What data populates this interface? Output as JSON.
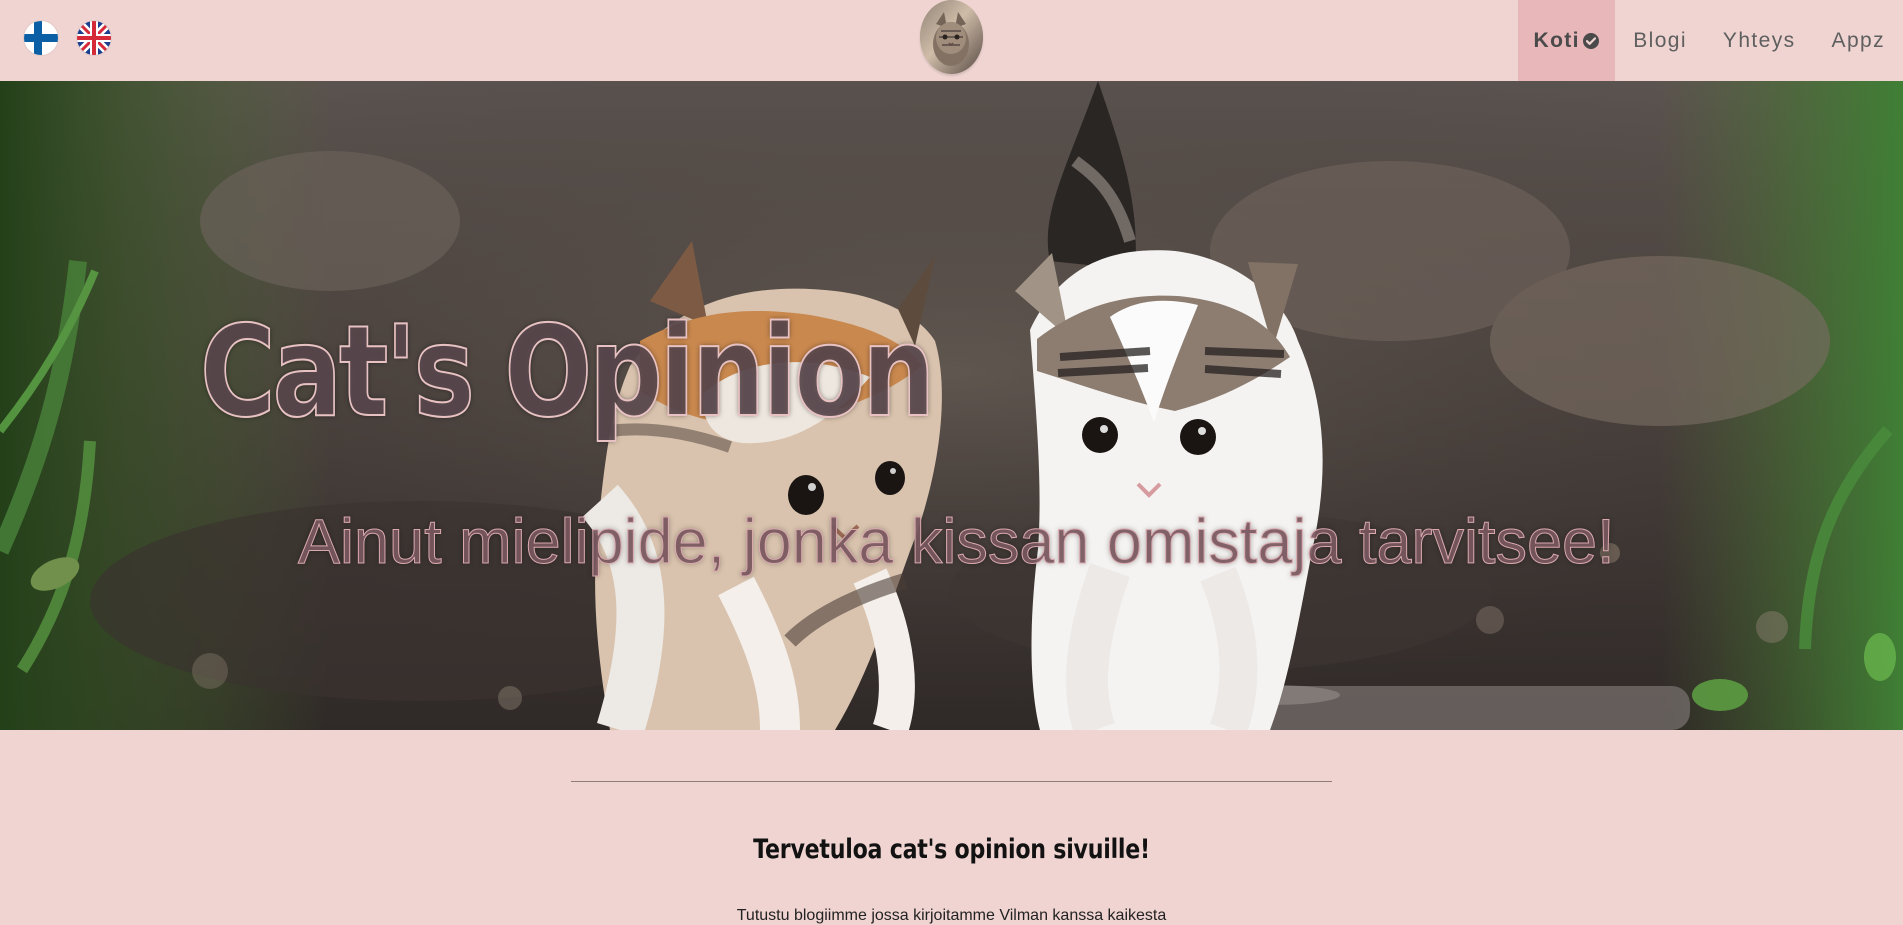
{
  "header": {
    "languages": [
      {
        "name": "fi-flag-icon"
      },
      {
        "name": "gb-flag-icon"
      }
    ],
    "logo": {
      "name": "logo-avatar-icon"
    },
    "nav": {
      "items": [
        {
          "label": "Koti",
          "active": true
        },
        {
          "label": "Blogi",
          "active": false
        },
        {
          "label": "Yhteys",
          "active": false
        },
        {
          "label": "Appz",
          "active": false
        }
      ],
      "active_icon": "check-circle-icon"
    }
  },
  "hero": {
    "title": "Cat's Opinion",
    "subtitle": "Ainut mielipide, jonka kissan omistaja tarvitsee!"
  },
  "intro": {
    "heading": "Tervetuloa cat's opinion sivuille!",
    "text": "Tutustu blogiimme jossa kirjoitamme Vilman kanssa kaikesta"
  },
  "colors": {
    "page_background": "#f0d4d2",
    "active_nav_background": "#e7b7ba",
    "nav_text": "#5f5f5f",
    "hero_title_fill": "#5c4a50",
    "hero_title_outline": "#e8c2c3",
    "hero_subtitle_fill": "#7a5860"
  }
}
